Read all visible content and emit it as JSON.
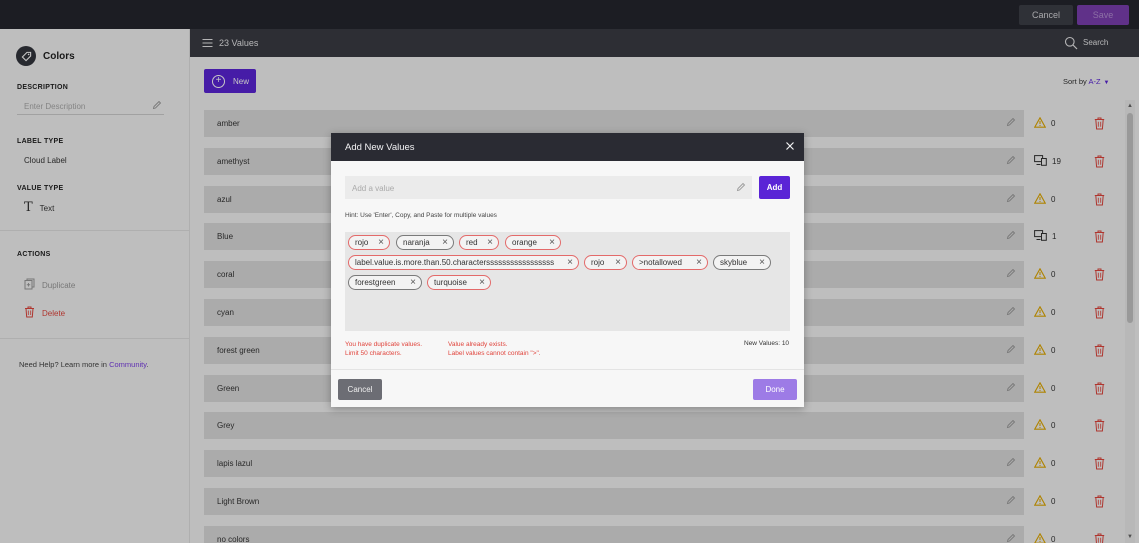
{
  "topbar": {
    "cancel_label": "Cancel",
    "save_label": "Save"
  },
  "left_panel": {
    "title": "Colors",
    "description_heading": "DESCRIPTION",
    "description_placeholder": "Enter Description",
    "label_type_heading": "LABEL TYPE",
    "label_type_value": "Cloud Label",
    "value_type_heading": "VALUE TYPE",
    "value_type_value": "Text",
    "actions_heading": "ACTIONS",
    "duplicate_label": "Duplicate",
    "delete_label": "Delete",
    "help_text": "Need Help? Learn more in ",
    "help_link": "Community",
    "help_suffix": "."
  },
  "list_header": {
    "count": "23 Values",
    "search_label": "Search"
  },
  "main": {
    "new_label": "New",
    "sort_prefix": "Sort by ",
    "sort_value": "A-Z",
    "rows": [
      {
        "label": "amber",
        "count": "0"
      },
      {
        "label": "amethyst",
        "count": "19"
      },
      {
        "label": "azul",
        "count": "0"
      },
      {
        "label": "Blue",
        "count": "1"
      },
      {
        "label": "coral",
        "count": "0"
      },
      {
        "label": "cyan",
        "count": "0"
      },
      {
        "label": "forest green",
        "count": "0"
      },
      {
        "label": "Green",
        "count": "0"
      },
      {
        "label": "Grey",
        "count": "0"
      },
      {
        "label": "lapis lazul",
        "count": "0"
      },
      {
        "label": "Light Brown",
        "count": "0"
      },
      {
        "label": "no colors",
        "count": "0"
      }
    ]
  },
  "modal": {
    "title": "Add New Values",
    "input_placeholder": "Add a value",
    "add_label": "Add",
    "hint": "Hint: Use 'Enter', Copy, and Paste for multiple values",
    "chips": [
      {
        "label": "rojo"
      },
      {
        "label": "naranja"
      },
      {
        "label": "red"
      },
      {
        "label": "orange"
      },
      {
        "label": "label.value.is.more.than.50.charactersssssssssssssssss"
      },
      {
        "label": "rojo"
      },
      {
        "label": ">notallowed"
      },
      {
        "label": "skyblue"
      },
      {
        "label": "forestgreen"
      },
      {
        "label": "turquoise"
      }
    ],
    "error_duplicate": "You have duplicate values.",
    "error_limit": "Limit 50 characters.",
    "error_exists": "Value already exists.",
    "error_char": "Label values cannot contain \">\".",
    "new_values": "New Values: 10",
    "cancel_label": "Cancel",
    "done_label": "Done"
  },
  "colors": {
    "accent": "#5a24d6",
    "error": "#e0443c",
    "warning": "#e0a800",
    "delete": "#e0443c"
  }
}
